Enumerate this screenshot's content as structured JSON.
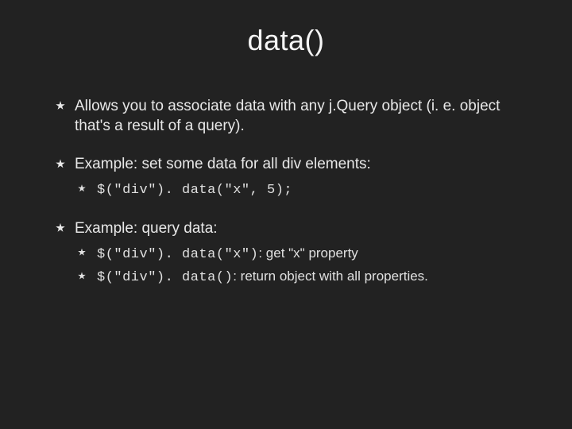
{
  "title": "data()",
  "bullets": {
    "b1": "Allows you to associate data with any j.Query object (i. e. object that's a result of a query).",
    "b2": "Example: set some data for all div elements:",
    "b2_sub1_code": "$(\"div\"). data(\"x\", 5);",
    "b3": "Example: query data:",
    "b3_sub1_code": "$(\"div\"). data(\"x\")",
    "b3_sub1_text": ": get \"x\" property",
    "b3_sub2_code": "$(\"div\"). data()",
    "b3_sub2_text": ": return object with all properties."
  }
}
